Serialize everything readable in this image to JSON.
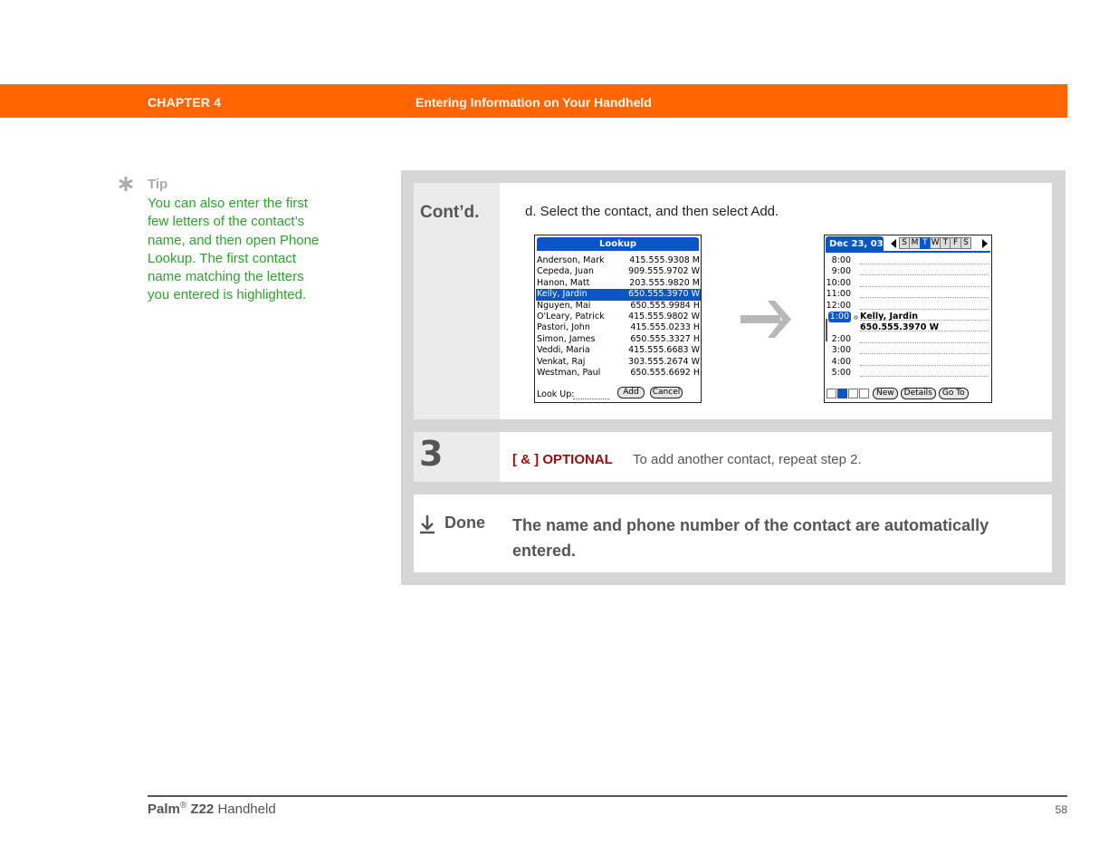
{
  "header": {
    "chapter": "CHAPTER 4",
    "title": "Entering Information on Your Handheld",
    "bar_color": "#ff6600"
  },
  "tip": {
    "icon": "asterisk-icon",
    "label": "Tip",
    "text": "You can also enter the first few letters of the contact’s name, and then open Phone Lookup. The first contact name matching the letters you entered is highlighted.",
    "text_color": "#2aa52a"
  },
  "steps": {
    "contd": {
      "label": "Cont’d.",
      "text": "d.  Select the contact, and then select Add."
    },
    "step3": {
      "number": "3",
      "tag": "[ & ]  OPTIONAL",
      "text": "To add another contact, repeat step 2."
    },
    "done": {
      "icon": "down-arrow-icon",
      "label": "Done",
      "text": "The name and phone number of the contact are automatically entered."
    }
  },
  "lookup_screen": {
    "title": "Lookup",
    "contacts": [
      {
        "name": "Anderson, Mark",
        "phone": "415.555.9308 M",
        "selected": false
      },
      {
        "name": "Cepeda, Juan",
        "phone": "909.555.9702 W",
        "selected": false
      },
      {
        "name": "Hanon, Matt",
        "phone": "203.555.9820 M",
        "selected": false
      },
      {
        "name": "Kelly, Jardin",
        "phone": "650.555.3970 W",
        "selected": true
      },
      {
        "name": "Nguyen, Mai",
        "phone": "650.555.9984 H",
        "selected": false
      },
      {
        "name": "O'Leary, Patrick",
        "phone": "415.555.9802 W",
        "selected": false
      },
      {
        "name": "Pastori, John",
        "phone": "415.555.0233 H",
        "selected": false
      },
      {
        "name": "Simon, James",
        "phone": "650.555.3327 H",
        "selected": false
      },
      {
        "name": "Veddi, Maria",
        "phone": "415.555.6683 W",
        "selected": false
      },
      {
        "name": "Venkat, Raj",
        "phone": "303.555.2674 W",
        "selected": false
      },
      {
        "name": "Westman, Paul",
        "phone": "650.555.6692 H",
        "selected": false
      }
    ],
    "lookup_label": "Look Up:",
    "add_button": "Add",
    "cancel_button": "Cancel"
  },
  "calendar_screen": {
    "date": "Dec 23, 03",
    "days": [
      "S",
      "M",
      "T",
      "W",
      "T",
      "F",
      "S"
    ],
    "active_day_index": 2,
    "slots": [
      {
        "time": "8:00",
        "event": "",
        "active": false
      },
      {
        "time": "9:00",
        "event": "",
        "active": false
      },
      {
        "time": "10:00",
        "event": "",
        "active": false
      },
      {
        "time": "11:00",
        "event": "",
        "active": false
      },
      {
        "time": "12:00",
        "event": "",
        "active": false
      },
      {
        "time": "1:00",
        "event": "Kelly, Jardin",
        "active": true
      },
      {
        "time": "",
        "event": "650.555.3970 W",
        "active": false
      },
      {
        "time": "2:00",
        "event": "",
        "active": false
      },
      {
        "time": "3:00",
        "event": "",
        "active": false
      },
      {
        "time": "4:00",
        "event": "",
        "active": false
      },
      {
        "time": "5:00",
        "event": "",
        "active": false
      }
    ],
    "buttons": {
      "new": "New",
      "details": "Details",
      "goto": "Go To"
    },
    "accent_color": "#0a56c6"
  },
  "footer": {
    "brand": "Palm",
    "registered": "®",
    "model": "Z22",
    "product": "Handheld",
    "page_number": "58"
  }
}
